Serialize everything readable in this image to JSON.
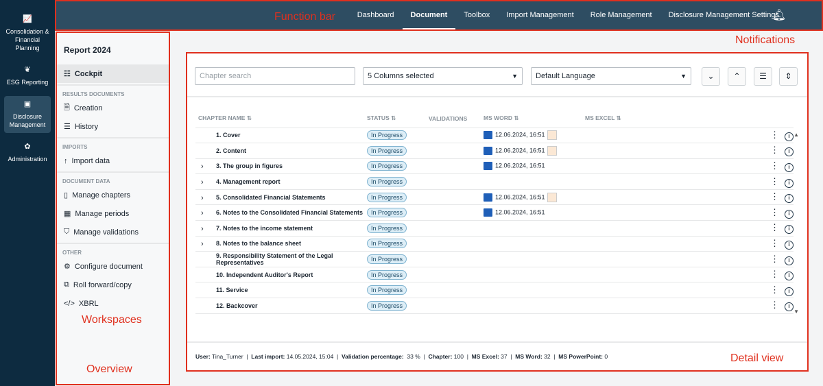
{
  "left_nav": [
    {
      "label": "Consolidation & Financial Planning",
      "icon": "chart-icon"
    },
    {
      "label": "ESG Reporting",
      "icon": "leaf-icon"
    },
    {
      "label": "Disclosure Management",
      "icon": "report-icon",
      "active": true
    },
    {
      "label": "Administration",
      "icon": "flower-icon"
    }
  ],
  "top_nav": {
    "items": [
      "Dashboard",
      "Document",
      "Toolbox",
      "Import Management",
      "Role Management",
      "Disclosure Management Settings"
    ],
    "active": "Document"
  },
  "annotations": {
    "function_bar": "Function bar",
    "notifications": "Notifications",
    "workspaces": "Workspaces",
    "overview": "Overview",
    "detail_view": "Detail view"
  },
  "overview": {
    "title": "Report 2024",
    "cockpit": "Cockpit",
    "sections": [
      {
        "title": "RESULTS DOCUMENTS",
        "items": [
          "Creation",
          "History"
        ]
      },
      {
        "title": "IMPORTS",
        "items": [
          "Import data"
        ]
      },
      {
        "title": "DOCUMENT DATA",
        "items": [
          "Manage chapters",
          "Manage periods",
          "Manage validations"
        ]
      },
      {
        "title": "OTHER",
        "items": [
          "Configure document",
          "Roll forward/copy",
          "XBRL"
        ]
      }
    ]
  },
  "toolbar": {
    "search_placeholder": "Chapter search",
    "columns": "5 Columns selected",
    "language": "Default Language"
  },
  "table": {
    "headers": [
      "CHAPTER NAME",
      "STATUS",
      "VALIDATIONS",
      "MS WORD",
      "MS EXCEL"
    ],
    "rows": [
      {
        "name": "1. Cover",
        "status": "In Progress",
        "word": "12.06.2024, 16:51",
        "expand": false
      },
      {
        "name": "2. Content",
        "status": "In Progress",
        "word": "12.06.2024, 16:51",
        "expand": false
      },
      {
        "name": "3. The group in figures",
        "status": "In Progress",
        "word": "12.06.2024, 16:51",
        "expand": true
      },
      {
        "name": "4. Management report",
        "status": "In Progress",
        "word": "",
        "expand": true
      },
      {
        "name": "5. Consolidated Financial Statements",
        "status": "In Progress",
        "word": "12.06.2024, 16:51",
        "expand": true
      },
      {
        "name": "6. Notes to the Consolidated Financial Statements",
        "status": "In Progress",
        "word": "12.06.2024, 16:51",
        "expand": true
      },
      {
        "name": "7. Notes to the income statement",
        "status": "In Progress",
        "word": "",
        "expand": true
      },
      {
        "name": "8. Notes to the balance sheet",
        "status": "In Progress",
        "word": "",
        "expand": true
      },
      {
        "name": "9. Responsibility Statement of the Legal Representatives",
        "status": "In Progress",
        "word": "",
        "expand": false
      },
      {
        "name": "10. Independent Auditor's Report",
        "status": "In Progress",
        "word": "",
        "expand": false
      },
      {
        "name": "11. Service",
        "status": "In Progress",
        "word": "",
        "expand": false
      },
      {
        "name": "12. Backcover",
        "status": "In Progress",
        "word": "",
        "expand": false
      }
    ]
  },
  "footer": {
    "user_label": "User:",
    "user": "Tina_Turner",
    "import_label": "Last import:",
    "import": "14.05.2024, 15:04",
    "val_label": "Validation percentage:",
    "val": "33 %",
    "chapter_label": "Chapter:",
    "chapter": "100",
    "excel_label": "MS Excel:",
    "excel": "37",
    "word_label": "MS Word:",
    "word": "32",
    "ppt_label": "MS PowerPoint:",
    "ppt": "0"
  }
}
